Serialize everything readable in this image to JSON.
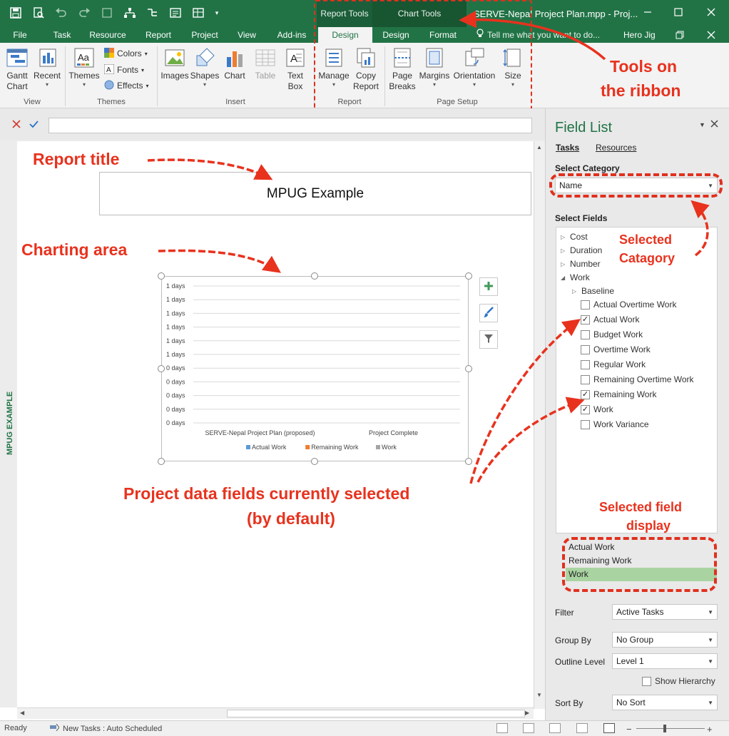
{
  "window": {
    "title": "SERVE-Nepal Project Plan.mpp - Proj...",
    "contextual_tabs": {
      "report_tools": "Report Tools",
      "chart_tools": "Chart Tools"
    }
  },
  "tabs": [
    "File",
    "Task",
    "Resource",
    "Report",
    "Project",
    "View",
    "Add-ins",
    "Design",
    "Design",
    "Format"
  ],
  "tell_me": "Tell me what you want to do...",
  "user": "Hero Jig",
  "ribbon": {
    "gantt_chart": "Gantt Chart",
    "recent": "Recent",
    "themes": "Themes",
    "colors": "Colors",
    "fonts": "Fonts",
    "effects": "Effects",
    "images": "Images",
    "shapes": "Shapes",
    "chart": "Chart",
    "table": "Table",
    "text_box": "Text Box",
    "manage": "Manage",
    "copy_report": "Copy Report",
    "page_breaks": "Page Breaks",
    "margins": "Margins",
    "orientation": "Orientation",
    "size": "Size",
    "groups": {
      "view": "View",
      "themes": "Themes",
      "insert": "Insert",
      "report": "Report",
      "page_setup": "Page Setup"
    }
  },
  "report": {
    "side_label": "MPUG EXAMPLE",
    "title": "MPUG Example"
  },
  "chart_data": {
    "type": "bar",
    "categories": [
      "SERVE-Nepal Project Plan (proposed)",
      "Project Complete"
    ],
    "series": [
      {
        "name": "Actual Work",
        "color": "#5b9bd5",
        "values": [
          0,
          0
        ]
      },
      {
        "name": "Remaining Work",
        "color": "#ed7d31",
        "values": [
          0,
          0
        ]
      },
      {
        "name": "Work",
        "color": "#a5a5a5",
        "values": [
          0,
          0
        ]
      }
    ],
    "y_tick_labels": [
      "1 days",
      "1 days",
      "1 days",
      "1 days",
      "1 days",
      "1 days",
      "0 days",
      "0 days",
      "0 days",
      "0 days",
      "0 days"
    ],
    "grid": true,
    "legend": "bottom"
  },
  "field_list": {
    "title": "Field List",
    "tabs": {
      "tasks": "Tasks",
      "resources": "Resources"
    },
    "select_category_label": "Select Category",
    "category_value": "Name",
    "select_fields_label": "Select Fields",
    "fields": {
      "cost": "Cost",
      "duration": "Duration",
      "number": "Number",
      "work": "Work",
      "baseline": "Baseline",
      "work_children": [
        {
          "label": "Actual Overtime Work",
          "checked": false
        },
        {
          "label": "Actual Work",
          "checked": true
        },
        {
          "label": "Budget Work",
          "checked": false
        },
        {
          "label": "Overtime Work",
          "checked": false
        },
        {
          "label": "Regular Work",
          "checked": false
        },
        {
          "label": "Remaining Overtime Work",
          "checked": false
        },
        {
          "label": "Remaining Work",
          "checked": true
        },
        {
          "label": "Work",
          "checked": true
        },
        {
          "label": "Work Variance",
          "checked": false
        }
      ]
    },
    "selected": [
      "Actual Work",
      "Remaining Work",
      "Work"
    ],
    "filter_label": "Filter",
    "filter_value": "Active Tasks",
    "group_by_label": "Group By",
    "group_by_value": "No Group",
    "outline_level_label": "Outline Level",
    "outline_level_value": "Level 1",
    "show_hierarchy": "Show Hierarchy",
    "sort_by_label": "Sort By",
    "sort_by_value": "No Sort"
  },
  "annotations": {
    "tools_on_ribbon": "Tools on",
    "tools_on_ribbon_2": "the ribbon",
    "report_title": "Report title",
    "charting_area": "Charting area",
    "selected_category": "Selected",
    "selected_category_2": "Catagory",
    "project_fields": "Project data fields currently selected",
    "project_fields_2": "(by default)",
    "selected_field_display": "Selected field",
    "selected_field_display_2": "display"
  },
  "status": {
    "ready": "Ready",
    "new_tasks": "New Tasks : Auto Scheduled"
  }
}
